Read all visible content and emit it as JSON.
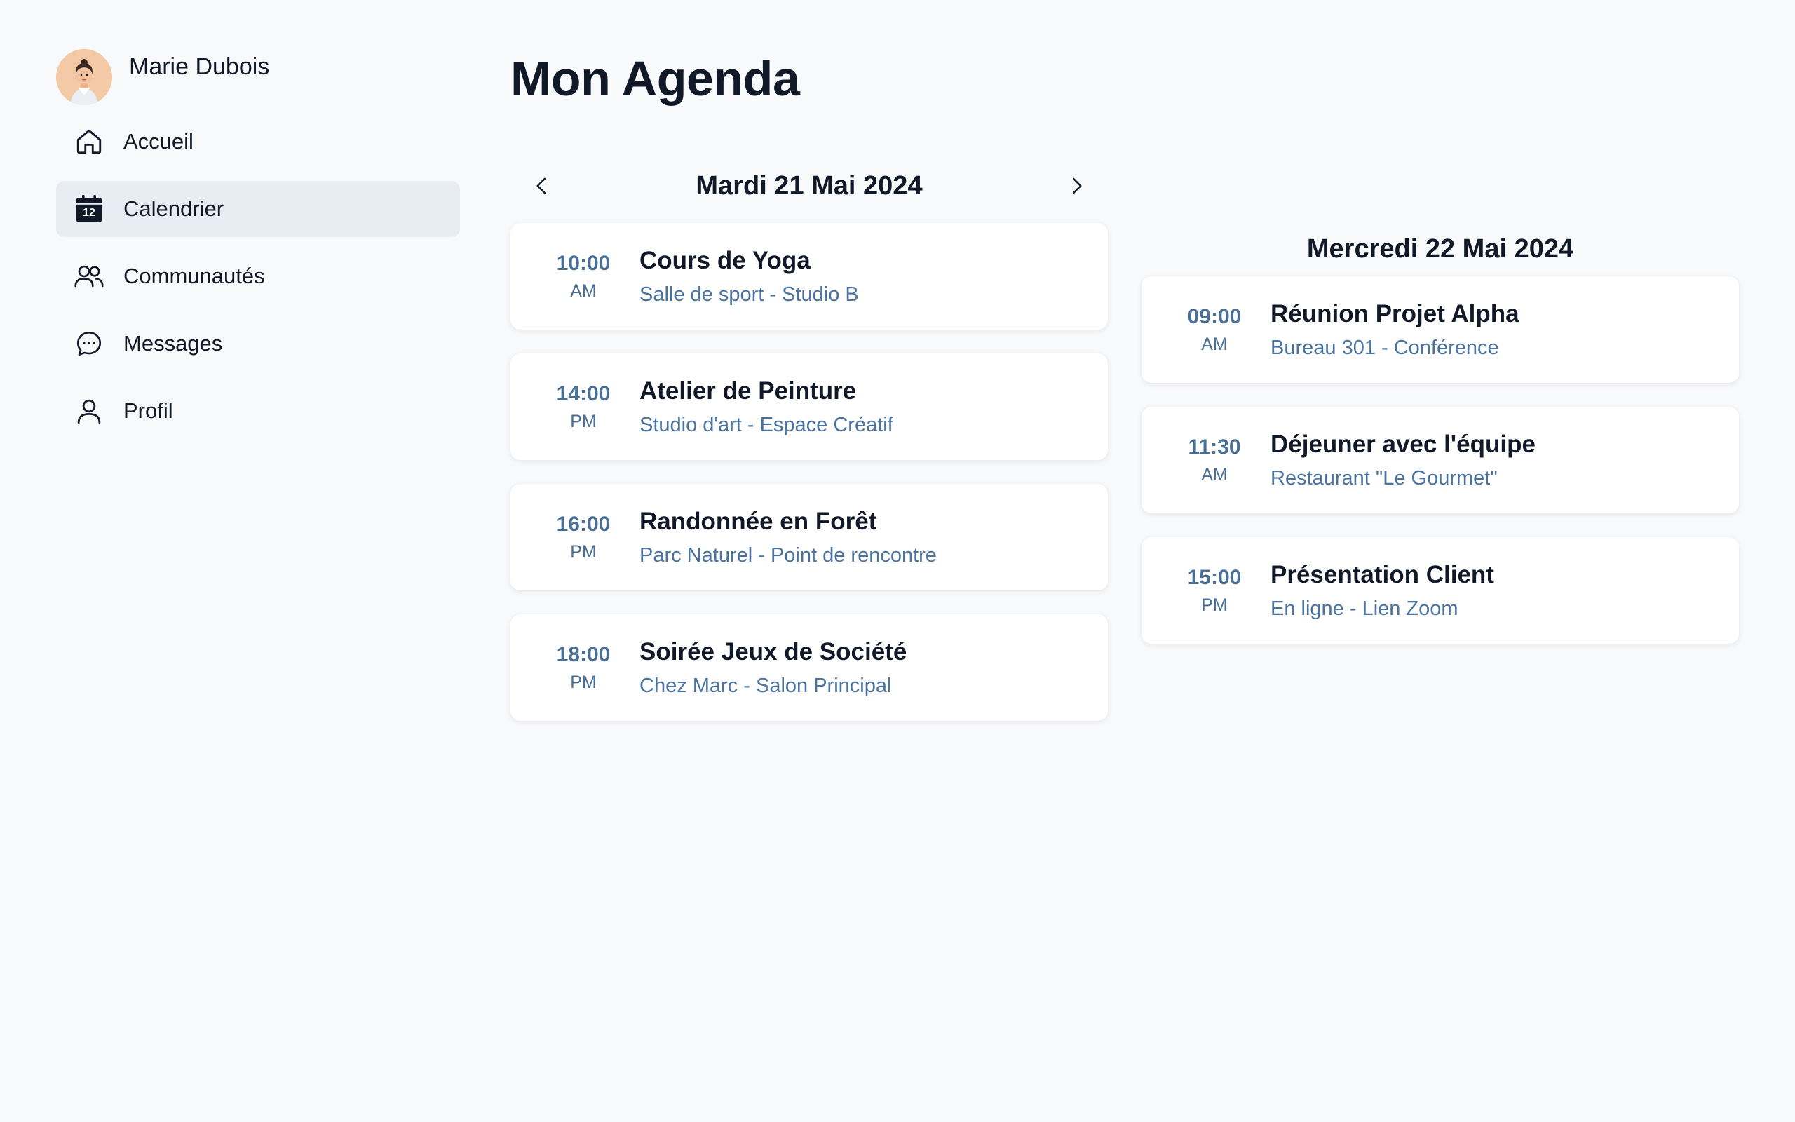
{
  "user": {
    "name": "Marie Dubois"
  },
  "sidebar": {
    "items": [
      {
        "label": "Accueil",
        "icon": "home-icon"
      },
      {
        "label": "Calendrier",
        "icon": "calendar-icon",
        "active": true,
        "badge": "12"
      },
      {
        "label": "Communautés",
        "icon": "users-icon"
      },
      {
        "label": "Messages",
        "icon": "chat-icon"
      },
      {
        "label": "Profil",
        "icon": "user-icon"
      }
    ]
  },
  "page": {
    "title": "Mon Agenda"
  },
  "days": [
    {
      "title": "Mardi 21 Mai 2024",
      "events": [
        {
          "time": "10:00",
          "ampm": "AM",
          "title": "Cours de Yoga",
          "location": "Salle de sport - Studio B"
        },
        {
          "time": "14:00",
          "ampm": "PM",
          "title": "Atelier de Peinture",
          "location": "Studio d'art - Espace Créatif"
        },
        {
          "time": "16:00",
          "ampm": "PM",
          "title": "Randonnée en Forêt",
          "location": "Parc Naturel - Point de rencontre"
        },
        {
          "time": "18:00",
          "ampm": "PM",
          "title": "Soirée Jeux de Société",
          "location": "Chez Marc - Salon Principal"
        }
      ]
    },
    {
      "title": "Mercredi 22 Mai 2024",
      "events": [
        {
          "time": "09:00",
          "ampm": "AM",
          "title": "Réunion Projet Alpha",
          "location": "Bureau 301 - Conférence"
        },
        {
          "time": "11:30",
          "ampm": "AM",
          "title": "Déjeuner avec l'équipe",
          "location": "Restaurant \"Le Gourmet\""
        },
        {
          "time": "15:00",
          "ampm": "PM",
          "title": "Présentation Client",
          "location": "En ligne - Lien Zoom"
        }
      ]
    }
  ],
  "colors": {
    "accent_time": "#4a6f95",
    "location_text": "#4a73a0",
    "active_nav_bg": "#e8edf3",
    "page_bg": "#f8f9fb"
  }
}
